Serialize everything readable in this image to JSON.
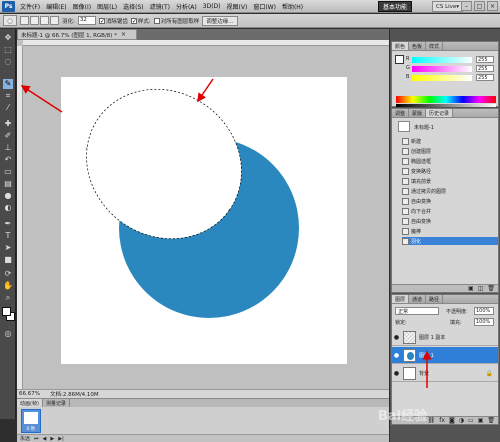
{
  "app": {
    "logo": "Ps",
    "zoom_display": "66.7"
  },
  "menu": [
    "文件(F)",
    "编辑(E)",
    "图像(I)",
    "图层(L)",
    "选择(S)",
    "滤镜(T)",
    "分析(A)",
    "3D(D)",
    "视图(V)",
    "窗口(W)",
    "帮助(H)"
  ],
  "workspace": {
    "label": "基本功能",
    "more": "»",
    "cs_live": "CS Live▾"
  },
  "options": {
    "feather_label": "羽化:",
    "feather_value": "32",
    "antialias_label": "消除锯齿",
    "style_label": "样式:",
    "style_value": "",
    "checkbox2_label": "对所有图层取样",
    "refine_btn": "调整边缘..."
  },
  "document": {
    "tab_title": "未标题-1 @ 66.7% (图层 1, RGB/8) *",
    "tab_close": "×"
  },
  "statusbar": {
    "zoom": "66.67%",
    "doc_info": "文档:2.86M/4.10M"
  },
  "animation": {
    "tabs": [
      "动画(帧)",
      "测量记录"
    ],
    "frame_time": "0 秒",
    "loop": "永远"
  },
  "panels": {
    "color_tabs": [
      "颜色",
      "色板",
      "样式"
    ],
    "color_values": [
      "255",
      "255",
      "255"
    ],
    "color_channels": [
      "R",
      "G",
      "B"
    ],
    "history_tabs": [
      "调整",
      "蒙版",
      "历史记录"
    ],
    "history_snapshot": "未标题-1",
    "history_items": [
      "新建",
      "创建图层",
      "椭圆选框",
      "变换路径",
      "填充前景",
      "通过拷贝的图层",
      "自由变换",
      "向下合并",
      "自由变换",
      "魔棒",
      "羽化"
    ],
    "layers_tabs": [
      "图层",
      "通道",
      "路径"
    ],
    "blend_mode": "正常",
    "opacity_label": "不透明度:",
    "opacity_value": "100%",
    "lock_label": "锁定:",
    "fill_label": "填充:",
    "fill_value": "100%",
    "layers": [
      {
        "name": "图层 1 副本"
      },
      {
        "name": "图层 1"
      },
      {
        "name": "背景"
      }
    ]
  },
  "colors": {
    "accent_blue": "#2a88bf",
    "selection_blue": "#2f7fd8",
    "arrow_red": "#e00000"
  },
  "watermark": "Bai经验"
}
